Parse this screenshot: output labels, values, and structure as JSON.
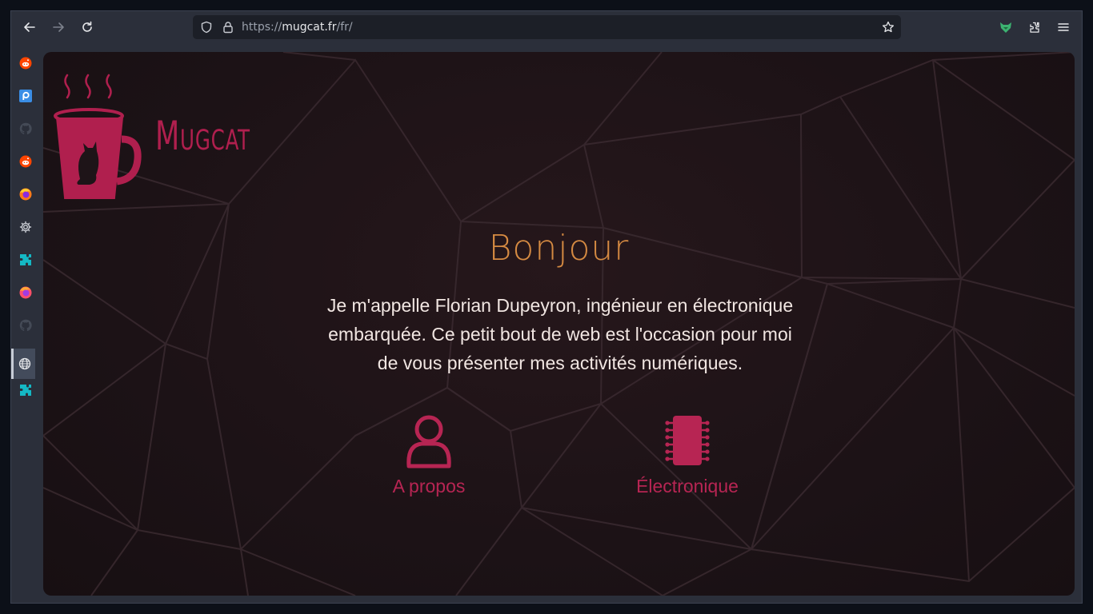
{
  "browser": {
    "url_scheme": "https://",
    "url_host": "mugcat.fr",
    "url_path": "/fr/",
    "buttons": {
      "back": "back-arrow-icon",
      "forward": "forward-arrow-icon",
      "reload": "reload-icon",
      "bookmark": "star-icon",
      "extension": "fox-extension-icon",
      "extensions": "puzzle-icon",
      "menu": "hamburger-menu-icon"
    }
  },
  "sidebar": {
    "items": [
      {
        "icon": "reddit-icon",
        "active": false
      },
      {
        "icon": "pcloud-icon",
        "active": false
      },
      {
        "icon": "github-icon",
        "active": false
      },
      {
        "icon": "reddit-icon",
        "active": false
      },
      {
        "icon": "firefox-icon",
        "active": false
      },
      {
        "icon": "gear-icon",
        "active": false
      },
      {
        "icon": "puzzle-icon",
        "active": false
      },
      {
        "icon": "firefox-icon",
        "active": false
      },
      {
        "icon": "github-icon",
        "active": false
      },
      {
        "icon": "globe-icon",
        "active": true
      },
      {
        "icon": "puzzle-icon",
        "active": false
      }
    ]
  },
  "site": {
    "logo_text": "Mugcat",
    "title": "Bonjour",
    "intro_lines": [
      "Je m'appelle Florian Dupeyron, ingénieur en électronique",
      "embarquée. Ce petit bout de web est l'occasion pour moi",
      "de vous présenter mes activités numériques."
    ],
    "cards": [
      {
        "label": "A propos",
        "icon": "user-icon"
      },
      {
        "label": "Électronique",
        "icon": "chip-icon"
      }
    ]
  },
  "colors": {
    "accent": "#b01f4e",
    "title": "#d58a42",
    "text": "#f1e6e2",
    "background": "#1c1216",
    "browser_chrome": "#2b2f3a"
  }
}
